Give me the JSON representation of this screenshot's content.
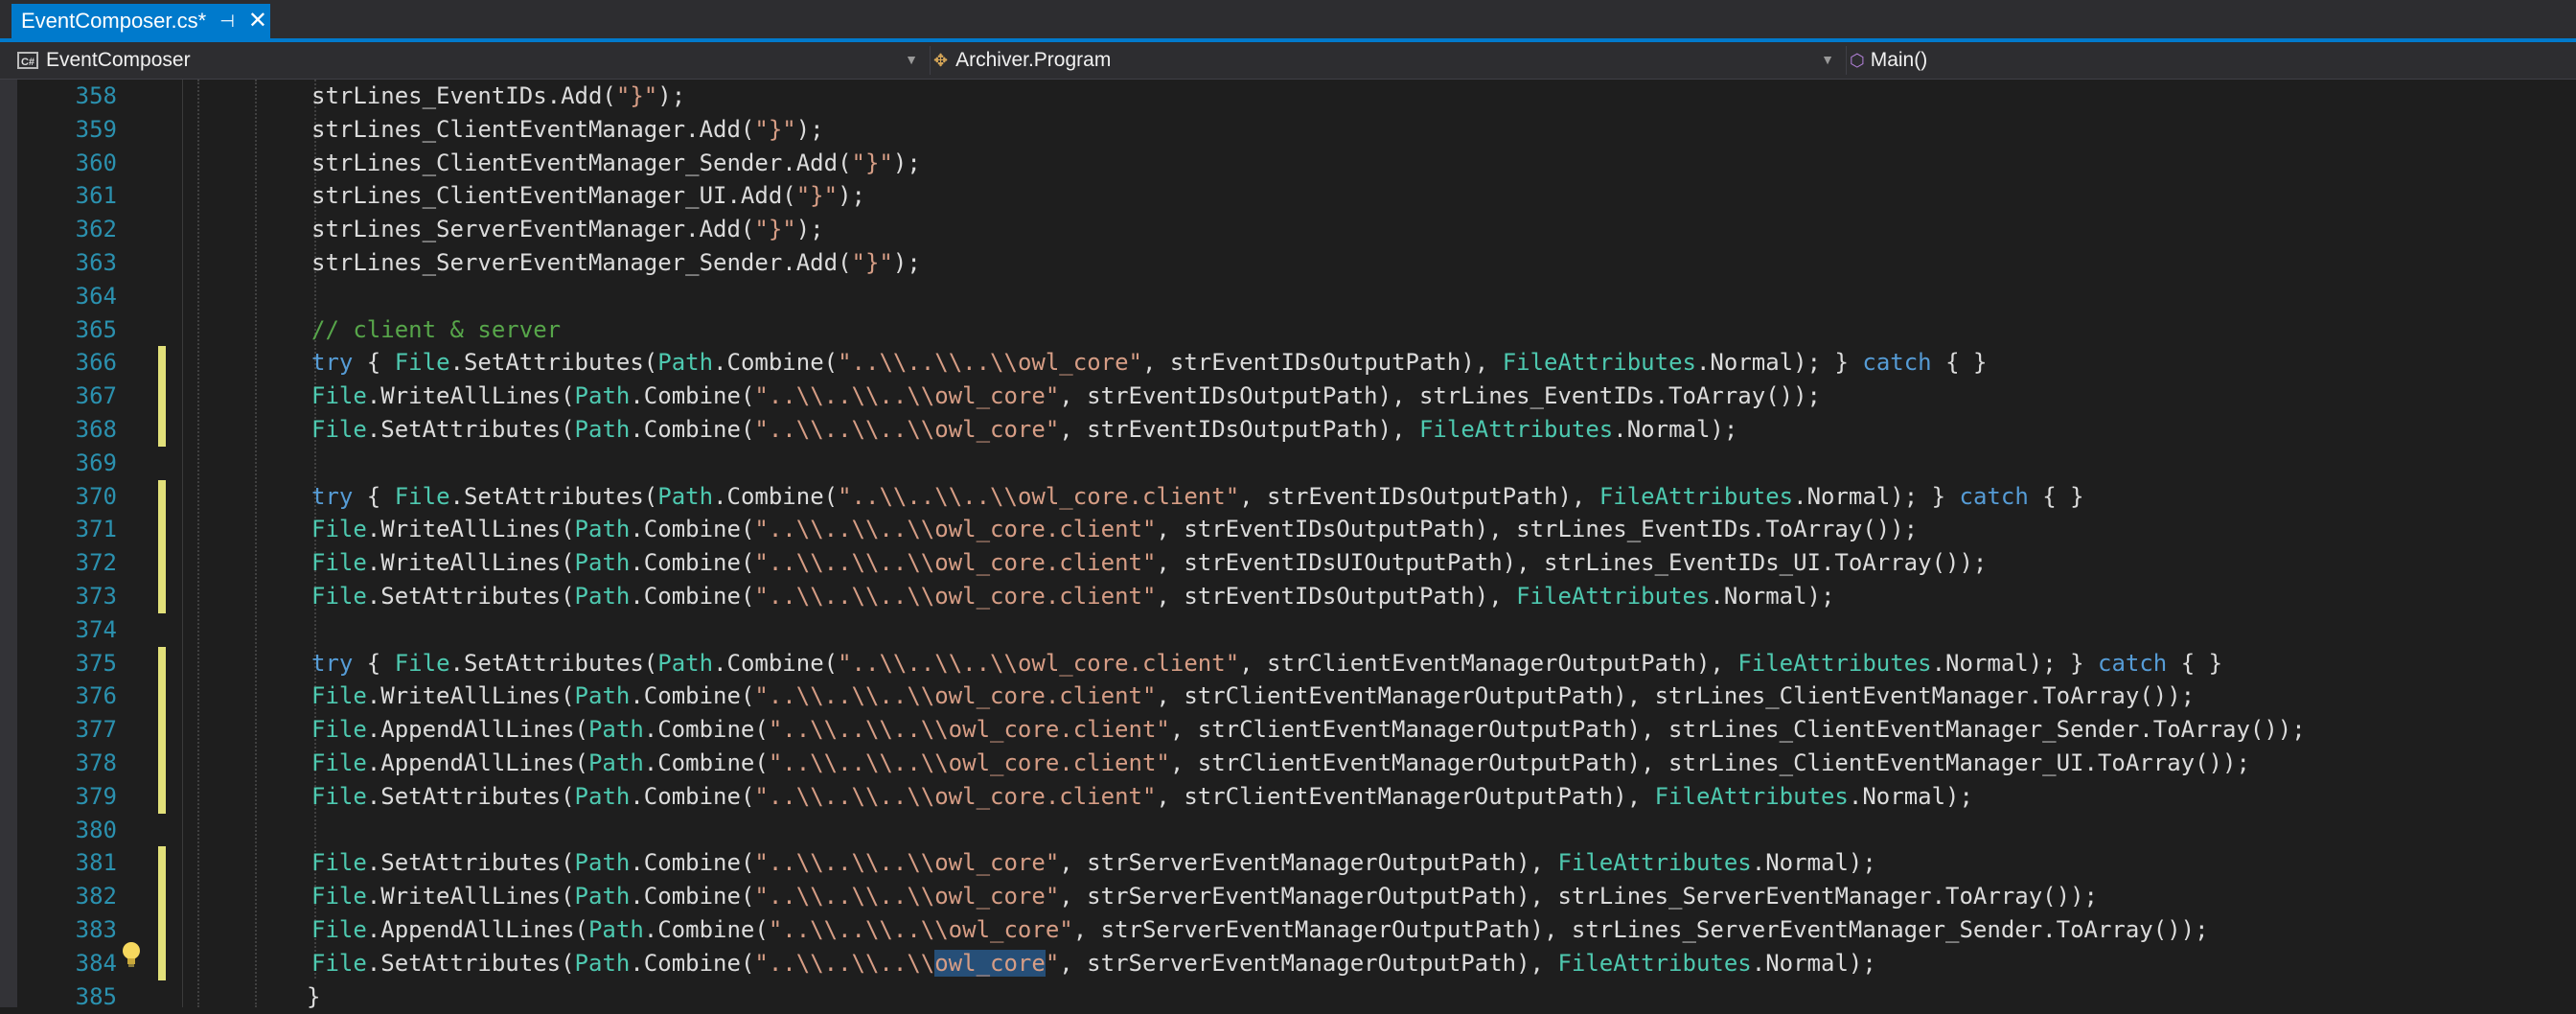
{
  "tab": {
    "title": "EventComposer.cs*",
    "pin": "⊣",
    "close": "✕"
  },
  "navbar": {
    "project": "EventComposer",
    "project_icon_text": "C#",
    "type": "Archiver.Program",
    "member": "Main()"
  },
  "colors": {
    "accent": "#007acc",
    "keyword": "#569cd6",
    "type": "#4ec9b0",
    "string": "#d69d85",
    "comment": "#57a64a",
    "linenum": "#2b91af",
    "changebar": "#e2e07a"
  },
  "editor": {
    "lines": [
      {
        "num": "358",
        "changed": false,
        "tokens": [
          {
            "c": "p",
            "t": "strLines_EventIDs.Add("
          },
          {
            "c": "s",
            "t": "\"}\""
          },
          {
            "c": "p",
            "t": ");"
          }
        ]
      },
      {
        "num": "359",
        "changed": false,
        "tokens": [
          {
            "c": "p",
            "t": "strLines_ClientEventManager.Add("
          },
          {
            "c": "s",
            "t": "\"}\""
          },
          {
            "c": "p",
            "t": ");"
          }
        ]
      },
      {
        "num": "360",
        "changed": false,
        "tokens": [
          {
            "c": "p",
            "t": "strLines_ClientEventManager_Sender.Add("
          },
          {
            "c": "s",
            "t": "\"}\""
          },
          {
            "c": "p",
            "t": ");"
          }
        ]
      },
      {
        "num": "361",
        "changed": false,
        "tokens": [
          {
            "c": "p",
            "t": "strLines_ClientEventManager_UI.Add("
          },
          {
            "c": "s",
            "t": "\"}\""
          },
          {
            "c": "p",
            "t": ");"
          }
        ]
      },
      {
        "num": "362",
        "changed": false,
        "tokens": [
          {
            "c": "p",
            "t": "strLines_ServerEventManager.Add("
          },
          {
            "c": "s",
            "t": "\"}\""
          },
          {
            "c": "p",
            "t": ");"
          }
        ]
      },
      {
        "num": "363",
        "changed": false,
        "tokens": [
          {
            "c": "p",
            "t": "strLines_ServerEventManager_Sender.Add("
          },
          {
            "c": "s",
            "t": "\"}\""
          },
          {
            "c": "p",
            "t": ");"
          }
        ]
      },
      {
        "num": "364",
        "changed": false,
        "tokens": []
      },
      {
        "num": "365",
        "changed": false,
        "tokens": [
          {
            "c": "c",
            "t": "// client & server"
          }
        ]
      },
      {
        "num": "366",
        "changed": true,
        "tokens": [
          {
            "c": "k",
            "t": "try"
          },
          {
            "c": "p",
            "t": " { "
          },
          {
            "c": "t",
            "t": "File"
          },
          {
            "c": "p",
            "t": ".SetAttributes("
          },
          {
            "c": "t",
            "t": "Path"
          },
          {
            "c": "p",
            "t": ".Combine("
          },
          {
            "c": "s",
            "t": "\"..\\\\..\\\\..\\\\owl_core\""
          },
          {
            "c": "p",
            "t": ", strEventIDsOutputPath), "
          },
          {
            "c": "t",
            "t": "FileAttributes"
          },
          {
            "c": "p",
            "t": ".Normal); } "
          },
          {
            "c": "k",
            "t": "catch"
          },
          {
            "c": "p",
            "t": " { }"
          }
        ]
      },
      {
        "num": "367",
        "changed": true,
        "tokens": [
          {
            "c": "t",
            "t": "File"
          },
          {
            "c": "p",
            "t": ".WriteAllLines("
          },
          {
            "c": "t",
            "t": "Path"
          },
          {
            "c": "p",
            "t": ".Combine("
          },
          {
            "c": "s",
            "t": "\"..\\\\..\\\\..\\\\owl_core\""
          },
          {
            "c": "p",
            "t": ", strEventIDsOutputPath), strLines_EventIDs.ToArray());"
          }
        ]
      },
      {
        "num": "368",
        "changed": true,
        "tokens": [
          {
            "c": "t",
            "t": "File"
          },
          {
            "c": "p",
            "t": ".SetAttributes("
          },
          {
            "c": "t",
            "t": "Path"
          },
          {
            "c": "p",
            "t": ".Combine("
          },
          {
            "c": "s",
            "t": "\"..\\\\..\\\\..\\\\owl_core\""
          },
          {
            "c": "p",
            "t": ", strEventIDsOutputPath), "
          },
          {
            "c": "t",
            "t": "FileAttributes"
          },
          {
            "c": "p",
            "t": ".Normal);"
          }
        ]
      },
      {
        "num": "369",
        "changed": false,
        "tokens": []
      },
      {
        "num": "370",
        "changed": true,
        "tokens": [
          {
            "c": "k",
            "t": "try"
          },
          {
            "c": "p",
            "t": " { "
          },
          {
            "c": "t",
            "t": "File"
          },
          {
            "c": "p",
            "t": ".SetAttributes("
          },
          {
            "c": "t",
            "t": "Path"
          },
          {
            "c": "p",
            "t": ".Combine("
          },
          {
            "c": "s",
            "t": "\"..\\\\..\\\\..\\\\owl_core.client\""
          },
          {
            "c": "p",
            "t": ", strEventIDsOutputPath), "
          },
          {
            "c": "t",
            "t": "FileAttributes"
          },
          {
            "c": "p",
            "t": ".Normal); } "
          },
          {
            "c": "k",
            "t": "catch"
          },
          {
            "c": "p",
            "t": " { }"
          }
        ]
      },
      {
        "num": "371",
        "changed": true,
        "tokens": [
          {
            "c": "t",
            "t": "File"
          },
          {
            "c": "p",
            "t": ".WriteAllLines("
          },
          {
            "c": "t",
            "t": "Path"
          },
          {
            "c": "p",
            "t": ".Combine("
          },
          {
            "c": "s",
            "t": "\"..\\\\..\\\\..\\\\owl_core.client\""
          },
          {
            "c": "p",
            "t": ", strEventIDsOutputPath), strLines_EventIDs.ToArray());"
          }
        ]
      },
      {
        "num": "372",
        "changed": true,
        "tokens": [
          {
            "c": "t",
            "t": "File"
          },
          {
            "c": "p",
            "t": ".WriteAllLines("
          },
          {
            "c": "t",
            "t": "Path"
          },
          {
            "c": "p",
            "t": ".Combine("
          },
          {
            "c": "s",
            "t": "\"..\\\\..\\\\..\\\\owl_core.client\""
          },
          {
            "c": "p",
            "t": ", strEventIDsUIOutputPath), strLines_EventIDs_UI.ToArray());"
          }
        ]
      },
      {
        "num": "373",
        "changed": true,
        "tokens": [
          {
            "c": "t",
            "t": "File"
          },
          {
            "c": "p",
            "t": ".SetAttributes("
          },
          {
            "c": "t",
            "t": "Path"
          },
          {
            "c": "p",
            "t": ".Combine("
          },
          {
            "c": "s",
            "t": "\"..\\\\..\\\\..\\\\owl_core.client\""
          },
          {
            "c": "p",
            "t": ", strEventIDsOutputPath), "
          },
          {
            "c": "t",
            "t": "FileAttributes"
          },
          {
            "c": "p",
            "t": ".Normal);"
          }
        ]
      },
      {
        "num": "374",
        "changed": false,
        "tokens": []
      },
      {
        "num": "375",
        "changed": true,
        "tokens": [
          {
            "c": "k",
            "t": "try"
          },
          {
            "c": "p",
            "t": " { "
          },
          {
            "c": "t",
            "t": "File"
          },
          {
            "c": "p",
            "t": ".SetAttributes("
          },
          {
            "c": "t",
            "t": "Path"
          },
          {
            "c": "p",
            "t": ".Combine("
          },
          {
            "c": "s",
            "t": "\"..\\\\..\\\\..\\\\owl_core.client\""
          },
          {
            "c": "p",
            "t": ", strClientEventManagerOutputPath), "
          },
          {
            "c": "t",
            "t": "FileAttributes"
          },
          {
            "c": "p",
            "t": ".Normal); } "
          },
          {
            "c": "k",
            "t": "catch"
          },
          {
            "c": "p",
            "t": " { }"
          }
        ]
      },
      {
        "num": "376",
        "changed": true,
        "tokens": [
          {
            "c": "t",
            "t": "File"
          },
          {
            "c": "p",
            "t": ".WriteAllLines("
          },
          {
            "c": "t",
            "t": "Path"
          },
          {
            "c": "p",
            "t": ".Combine("
          },
          {
            "c": "s",
            "t": "\"..\\\\..\\\\..\\\\owl_core.client\""
          },
          {
            "c": "p",
            "t": ", strClientEventManagerOutputPath), strLines_ClientEventManager.ToArray());"
          }
        ]
      },
      {
        "num": "377",
        "changed": true,
        "tokens": [
          {
            "c": "t",
            "t": "File"
          },
          {
            "c": "p",
            "t": ".AppendAllLines("
          },
          {
            "c": "t",
            "t": "Path"
          },
          {
            "c": "p",
            "t": ".Combine("
          },
          {
            "c": "s",
            "t": "\"..\\\\..\\\\..\\\\owl_core.client\""
          },
          {
            "c": "p",
            "t": ", strClientEventManagerOutputPath), strLines_ClientEventManager_Sender.ToArray());"
          }
        ]
      },
      {
        "num": "378",
        "changed": true,
        "tokens": [
          {
            "c": "t",
            "t": "File"
          },
          {
            "c": "p",
            "t": ".AppendAllLines("
          },
          {
            "c": "t",
            "t": "Path"
          },
          {
            "c": "p",
            "t": ".Combine("
          },
          {
            "c": "s",
            "t": "\"..\\\\..\\\\..\\\\owl_core.client\""
          },
          {
            "c": "p",
            "t": ", strClientEventManagerOutputPath), strLines_ClientEventManager_UI.ToArray());"
          }
        ]
      },
      {
        "num": "379",
        "changed": true,
        "tokens": [
          {
            "c": "t",
            "t": "File"
          },
          {
            "c": "p",
            "t": ".SetAttributes("
          },
          {
            "c": "t",
            "t": "Path"
          },
          {
            "c": "p",
            "t": ".Combine("
          },
          {
            "c": "s",
            "t": "\"..\\\\..\\\\..\\\\owl_core.client\""
          },
          {
            "c": "p",
            "t": ", strClientEventManagerOutputPath), "
          },
          {
            "c": "t",
            "t": "FileAttributes"
          },
          {
            "c": "p",
            "t": ".Normal);"
          }
        ]
      },
      {
        "num": "380",
        "changed": false,
        "tokens": []
      },
      {
        "num": "381",
        "changed": true,
        "tokens": [
          {
            "c": "t",
            "t": "File"
          },
          {
            "c": "p",
            "t": ".SetAttributes("
          },
          {
            "c": "t",
            "t": "Path"
          },
          {
            "c": "p",
            "t": ".Combine("
          },
          {
            "c": "s",
            "t": "\"..\\\\..\\\\..\\\\owl_core\""
          },
          {
            "c": "p",
            "t": ", strServerEventManagerOutputPath), "
          },
          {
            "c": "t",
            "t": "FileAttributes"
          },
          {
            "c": "p",
            "t": ".Normal);"
          }
        ]
      },
      {
        "num": "382",
        "changed": true,
        "tokens": [
          {
            "c": "t",
            "t": "File"
          },
          {
            "c": "p",
            "t": ".WriteAllLines("
          },
          {
            "c": "t",
            "t": "Path"
          },
          {
            "c": "p",
            "t": ".Combine("
          },
          {
            "c": "s",
            "t": "\"..\\\\..\\\\..\\\\owl_core\""
          },
          {
            "c": "p",
            "t": ", strServerEventManagerOutputPath), strLines_ServerEventManager.ToArray());"
          }
        ]
      },
      {
        "num": "383",
        "changed": true,
        "tokens": [
          {
            "c": "t",
            "t": "File"
          },
          {
            "c": "p",
            "t": ".AppendAllLines("
          },
          {
            "c": "t",
            "t": "Path"
          },
          {
            "c": "p",
            "t": ".Combine("
          },
          {
            "c": "s",
            "t": "\"..\\\\..\\\\..\\\\owl_core\""
          },
          {
            "c": "p",
            "t": ", strServerEventManagerOutputPath), strLines_ServerEventManager_Sender.ToArray());"
          }
        ]
      },
      {
        "num": "384",
        "changed": true,
        "tokens": [
          {
            "c": "t",
            "t": "File"
          },
          {
            "c": "p",
            "t": ".SetAttributes("
          },
          {
            "c": "t",
            "t": "Path"
          },
          {
            "c": "p",
            "t": ".Combine("
          },
          {
            "c": "s",
            "t": "\"..\\\\..\\\\..\\\\"
          },
          {
            "c": "sel",
            "t": "owl_core"
          },
          {
            "c": "s",
            "t": "\""
          },
          {
            "c": "p",
            "t": ", strServerEventManagerOutputPath), "
          },
          {
            "c": "t",
            "t": "FileAttributes"
          },
          {
            "c": "p",
            "t": ".Normal);"
          }
        ]
      },
      {
        "num": "385",
        "changed": false,
        "tokens": [
          {
            "c": "p",
            "t": "}"
          }
        ]
      }
    ]
  }
}
